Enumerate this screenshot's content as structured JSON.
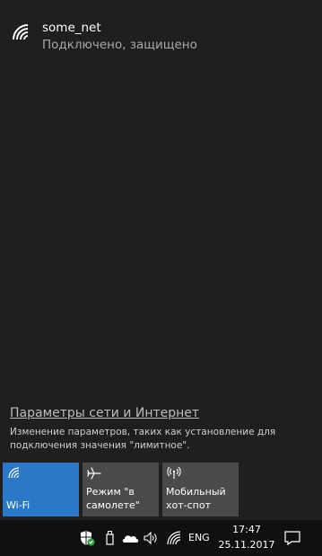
{
  "network": {
    "name": "some_net",
    "status": "Подключено, защищено",
    "icon": "wifi-icon"
  },
  "settings": {
    "link_label": "Параметры сети и Интернет",
    "description": "Изменение параметров, таких как установление для подключения значения \"лимитное\"."
  },
  "quick_actions": [
    {
      "label": "Wi-Fi",
      "icon": "wifi-icon",
      "active": true,
      "color": "#2b78c8"
    },
    {
      "label": "Режим \"в самолете\"",
      "icon": "airplane-icon",
      "active": false,
      "color": "#4a4a4a"
    },
    {
      "label": "Мобильный хот-спот",
      "icon": "hotspot-icon",
      "active": false,
      "color": "#4a4a4a"
    }
  ],
  "taskbar": {
    "language": "ENG",
    "time": "17:47",
    "date": "25.11.2017",
    "icons": [
      "defender-icon",
      "usb-icon",
      "onedrive-icon",
      "volume-icon",
      "wifi-icon",
      "notification-icon"
    ]
  },
  "colors": {
    "accent": "#2b78c8",
    "background": "#1f1f1f",
    "taskbar": "#101010"
  }
}
